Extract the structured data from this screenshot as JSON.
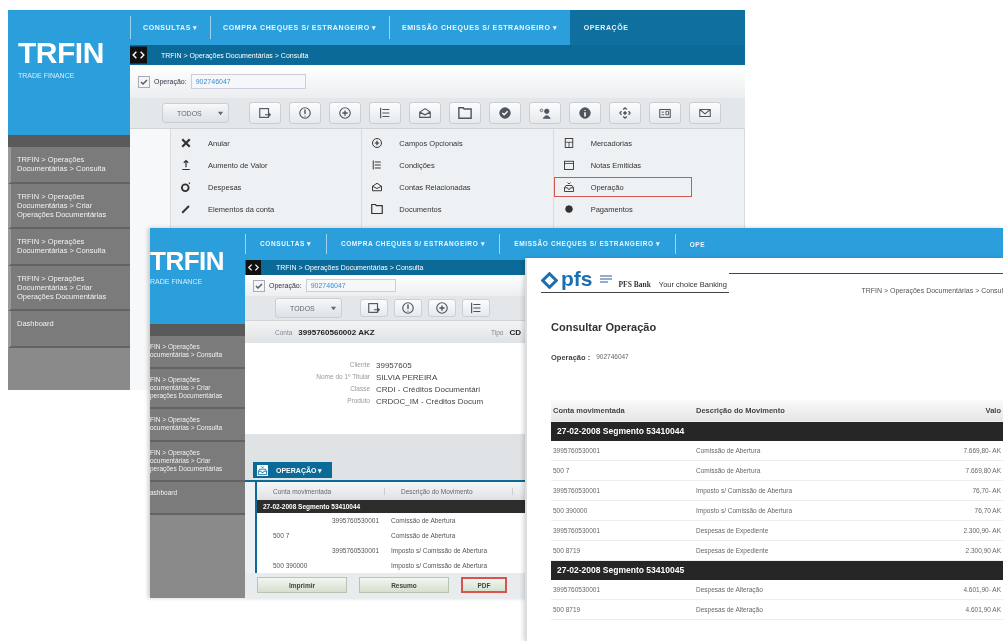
{
  "windows": [
    {
      "kind": "trfin",
      "logo": "TRFIN",
      "tagline": "TRADE FINANCE",
      "nav": [
        {
          "label": "CONSULTAS ▾",
          "selected": false
        },
        {
          "label": "COMPRA CHEQUES S/ ESTRANGEIRO ▾",
          "selected": false
        },
        {
          "label": "EMISSÃO CHEQUES S/ ESTRANGEIRO ▾",
          "selected": false
        },
        {
          "label": "OPERAÇÕE",
          "selected": true
        }
      ],
      "breadcrumb": "TRFIN > Operações Documentárias > Consulta",
      "operation_field": {
        "checked": true,
        "label": "Operação:",
        "value": "902746047"
      },
      "filter": {
        "value": "TODOS"
      },
      "sidebar": {
        "items": [
          "TRFIN > Operações Documentárias > Consulta",
          "TRFIN > Operações Documentárias > Criar Operações Documentárias",
          "TRFIN > Operações Documentárias > Consulta",
          "TRFIN > Operações Documentárias > Criar Operações Documentárias",
          "Dashboard"
        ]
      },
      "menu": {
        "columns": [
          [
            {
              "label": "Anular",
              "highlighted": false
            },
            {
              "label": "Aumento de Valor",
              "highlighted": false
            },
            {
              "label": "Despesas",
              "highlighted": false
            },
            {
              "label": "Elementos da conta",
              "highlighted": false
            }
          ],
          [
            {
              "label": "Campos Opcionais",
              "highlighted": false
            },
            {
              "label": "Condições",
              "highlighted": false
            },
            {
              "label": "Contas Relacionadas",
              "highlighted": false
            },
            {
              "label": "Documentos",
              "highlighted": false
            }
          ],
          [
            {
              "label": "Mercadorias",
              "highlighted": false
            },
            {
              "label": "Notas Emitidas",
              "highlighted": false
            },
            {
              "label": "Operação",
              "highlighted": true
            },
            {
              "label": "Pagamentos",
              "highlighted": false
            }
          ]
        ]
      }
    },
    {
      "kind": "trfin",
      "logo": "TRFIN",
      "tagline": "RADE FINANCE",
      "nav": [
        {
          "label": "CONSULTAS ▾",
          "selected": false
        },
        {
          "label": "COMPRA CHEQUES S/ ESTRANGEIRO ▾",
          "selected": false
        },
        {
          "label": "EMISSÃO CHEQUES S/ ESTRANGEIRO ▾",
          "selected": false
        },
        {
          "label": "OPE",
          "selected": false
        }
      ],
      "breadcrumb": "TRFIN > Operações Documentárias > Consulta",
      "operation_field": {
        "checked": true,
        "label": "Operação:",
        "value": "902746047"
      },
      "filter": {
        "value": "TODOS"
      },
      "sidebar": {
        "items": [
          "FIN > Operações\nocumentárias > Consulta",
          "FIN > Operações\nocumentárias > Criar\nperações Documentárias",
          "FIN > Operações\nocumentárias > Consulta",
          "FIN > Operações\nocumentárias > Criar\nperações Documentárias",
          "ashboard"
        ]
      },
      "account": {
        "label": "Conta",
        "value": "3995760560002 AKZ",
        "type_label": "Tipo",
        "type_value": "CD"
      },
      "details": [
        {
          "label": "Cliente",
          "value": "39957605"
        },
        {
          "label": "Nome do 1º Titular",
          "value": "SILVIA PEREIRA"
        },
        {
          "label": "Classe",
          "value": "CRDI - Créditos Documentári"
        },
        {
          "label": "Produto",
          "value": "CRDOC_IM - Créditos Docum"
        }
      ],
      "tab": {
        "label": "OPERAÇÃO ▾"
      },
      "table": {
        "columns": [
          "Conta movimentada",
          "Descrição do Movimento"
        ],
        "groups": [
          {
            "title": "27-02-2008 Segmento 53410044",
            "rows": [
              {
                "kind": "debit",
                "account": "3995760530001",
                "description": "Comissão de Abertura"
              },
              {
                "kind": "credit",
                "account": "500 7",
                "description": "Comissão de Abertura"
              },
              {
                "kind": "debit",
                "account": "3995760530001",
                "description": "Imposto s/ Comissão de Abertura"
              },
              {
                "kind": "credit",
                "account": "500 390000",
                "description": "Imposto s/ Comissão de Abertura"
              }
            ]
          }
        ]
      },
      "buttons": [
        {
          "label": "Imprimir",
          "highlighted": false
        },
        {
          "label": "Resumo",
          "highlighted": false
        },
        {
          "label": "PDF",
          "highlighted": true
        }
      ]
    },
    {
      "kind": "report",
      "brand": "pfs",
      "bank": "PFS Bank",
      "slogan": "Your choice Banking",
      "breadcrumb": "TRFIN > Operações Documentárias > Consul",
      "title": "Consultar Operação",
      "operation": {
        "label": "Operação :",
        "value": "902746047"
      },
      "table": {
        "columns": [
          "Conta movimentada",
          "Descrição do Movimento",
          "Valo"
        ],
        "groups": [
          {
            "title": "27-02-2008 Segmento 53410044",
            "rows": [
              {
                "account": "3995760530001",
                "description": "Comissão de Abertura",
                "value": "7.669,80- AK"
              },
              {
                "account": "500 7",
                "description": "Comissão de Abertura",
                "value": "7.669,80 AK"
              },
              {
                "account": "3995760530001",
                "description": "Imposto s/ Comissão de Abertura",
                "value": "76,70- AK"
              },
              {
                "account": "500 390000",
                "description": "Imposto s/ Comissão de Abertura",
                "value": "76,70 AK"
              },
              {
                "account": "3995760530001",
                "description": "Despesas de Expediente",
                "value": "2.300,90- AK"
              },
              {
                "account": "500 8719",
                "description": "Despesas de Expediente",
                "value": "2.300,90 AK"
              }
            ]
          },
          {
            "title": "27-02-2008 Segmento 53410045",
            "rows": [
              {
                "account": "3995760530001",
                "description": "Despesas de Alteração",
                "value": "4.601,90- AK"
              },
              {
                "account": "500 8719",
                "description": "Despesas de Alteração",
                "value": "4.601,90 AK"
              }
            ]
          }
        ]
      }
    }
  ]
}
